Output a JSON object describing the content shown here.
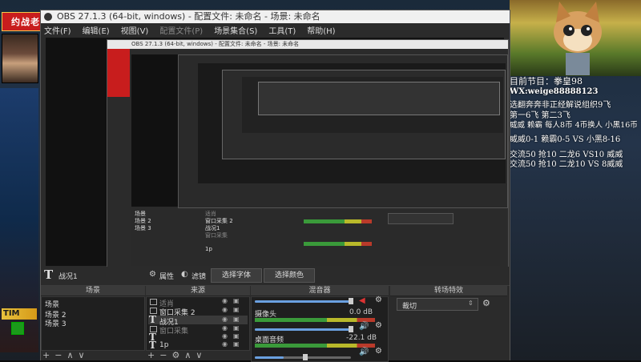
{
  "game": {
    "logo": "约战老王",
    "timer": "TIM"
  },
  "obs": {
    "title": "OBS 27.1.3 (64-bit, windows) - 配置文件: 未命名 - 场景: 未命名",
    "menu": [
      "文件(F)",
      "编辑(E)",
      "视图(V)",
      "配置文件(P)",
      "场景集合(S)",
      "工具(T)",
      "帮助(H)"
    ],
    "source_bar": {
      "label": "战况1",
      "properties": "属性",
      "filters": "滤镜",
      "select_font": "选择字体",
      "select_color": "选择颜色"
    },
    "scenes": {
      "header": "场景",
      "items": [
        "场景",
        "场景 2",
        "场景 3"
      ]
    },
    "sources": {
      "header": "来源",
      "items": [
        "适肖",
        "窗口采集 2",
        "战况1",
        "窗口采集",
        "",
        "1p"
      ]
    },
    "mixer": {
      "header": "混音器",
      "tracks": [
        {
          "name": "摄像头",
          "db": "0.0 dB",
          "level": 0.0
        },
        {
          "name": "桌面音频",
          "db": "-22.1 dB",
          "level": 0.75
        }
      ]
    },
    "transitions": {
      "header": "转场特效",
      "selected": "裁切"
    }
  },
  "overlay": {
    "lines": [
      "目前节目：拳皇98",
      "WX:weige88888123",
      "选翻奔奔非正经解说组织9飞",
      "第一6飞 第二3飞",
      "威威 赖霸 每人8币 4币换人 小黑16币",
      "威威0-1 赖霸0-5 VS 小黑8-16",
      "交流50 抢10 二龙6 VS10 威威",
      "交流50 抢10 二龙10 VS 8威威"
    ]
  },
  "nested": {
    "title_2": "OBS 27.1.3 (64-bit, windows) - 配置文件: 未命名 - 场景: 未命名",
    "scene_items": [
      "场景",
      "场景 2",
      "场景 3"
    ],
    "source_items": [
      "适肖",
      "窗口采集 2",
      "战况1",
      "窗口采集",
      "1p"
    ]
  }
}
